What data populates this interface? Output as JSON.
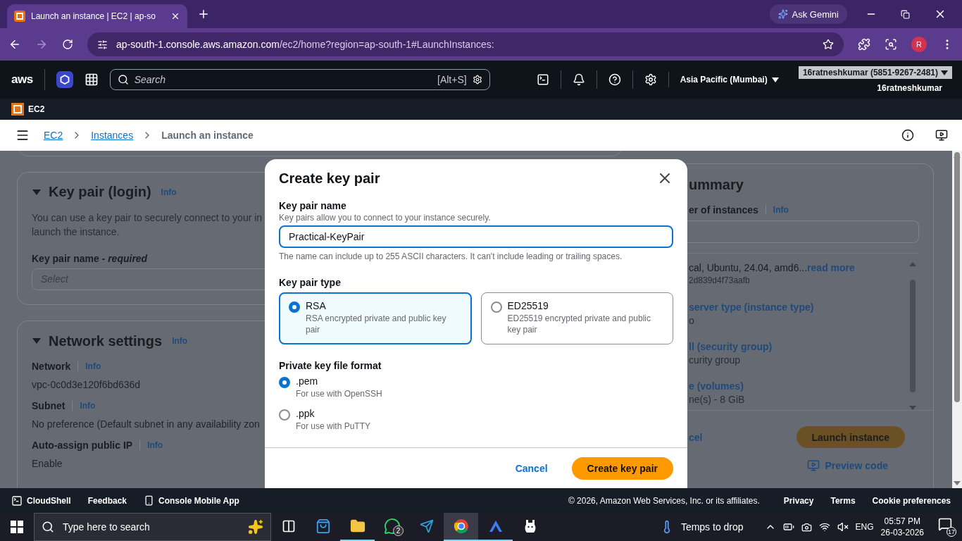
{
  "browser": {
    "tabs": [
      {
        "title": "Launch an instance | EC2 | ap-so",
        "selected": true
      }
    ],
    "ask_button": "Ask Gemini",
    "url_host": "ap-south-1.console.aws.amazon.com",
    "url_path": "/ec2/home?region=ap-south-1#LaunchInstances:",
    "profile_initial": "R"
  },
  "aws_header": {
    "logo": "aws",
    "search_placeholder": "Search",
    "search_shortcut": "[Alt+S]",
    "region": "Asia Pacific (Mumbai)",
    "account": "16ratneshkumar (5851-9267-2481)",
    "username": "16ratneshkumar"
  },
  "service_bar": {
    "service": "EC2"
  },
  "breadcrumbs": [
    {
      "label": "EC2",
      "kind": "link"
    },
    {
      "label": "Instances",
      "kind": "link"
    },
    {
      "label": "Launch an instance",
      "kind": "current"
    }
  ],
  "key_pair_section": {
    "title": "Key pair (login)",
    "info": "Info",
    "expanded": true,
    "description_lines": [
      "You can use a key pair to securely connect to your in",
      "launch the instance."
    ],
    "field_label": "Key pair name - *required*",
    "field_placeholder": "Select"
  },
  "network_section": {
    "title": "Network settings",
    "info": "Info",
    "expanded": true,
    "fields": [
      {
        "label": "Network",
        "info": "Info",
        "value": "vpc-0c0d3e120f6bd636d"
      },
      {
        "label": "Subnet",
        "info": "Info",
        "value": "No preference (Default subnet in any availability zon"
      },
      {
        "label": "Auto-assign public IP",
        "info": "Info",
        "value": "Enable"
      }
    ]
  },
  "summary": {
    "title": "ummary",
    "instances_label": "er of instances",
    "instances_info": "Info",
    "items": [
      {
        "kind": "text",
        "text": "cal, Ubuntu, 24.04, amd6...",
        "link": "read more",
        "sub": "2d839d4f73aafb"
      },
      {
        "kind": "heading",
        "text": "server type (instance type)",
        "sub": "o"
      },
      {
        "kind": "heading",
        "text": "ll (security group)",
        "sub": "curity group"
      },
      {
        "kind": "heading",
        "text": "e (volumes)",
        "sub": "ne(s) - 8 GiB"
      }
    ],
    "cancel": "cel",
    "launch": "Launch instance",
    "preview": "Preview code"
  },
  "modal": {
    "title": "Create key pair",
    "name_label": "Key pair name",
    "name_help": "Key pairs allow you to connect to your instance securely.",
    "name_value": "Practical-KeyPair",
    "name_constraint": "The name can include up to 255 ASCII characters. It can't include leading or trailing spaces.",
    "type_label": "Key pair type",
    "types": [
      {
        "label": "RSA",
        "description": "RSA encrypted private and public key pair",
        "selected": true
      },
      {
        "label": "ED25519",
        "description": "ED25519 encrypted private and public key pair",
        "selected": false
      }
    ],
    "format_label": "Private key file format",
    "formats": [
      {
        "label": ".pem",
        "description": "For use with OpenSSH",
        "selected": true
      },
      {
        "label": ".ppk",
        "description": "For use with PuTTY",
        "selected": false
      }
    ],
    "cancel": "Cancel",
    "submit": "Create key pair"
  },
  "footer": {
    "left": [
      {
        "kind": "cloudshell",
        "label": "CloudShell"
      },
      {
        "kind": "plain",
        "label": "Feedback"
      },
      {
        "kind": "mobile",
        "label": "Console Mobile App"
      }
    ],
    "copyright": "© 2026, Amazon Web Services, Inc. or its affiliates.",
    "links": [
      "Privacy",
      "Terms",
      "Cookie preferences"
    ]
  },
  "taskbar": {
    "search_placeholder": "Type here to search",
    "apps": [
      {
        "kind": "taskview",
        "running": false,
        "active": false
      },
      {
        "kind": "store",
        "running": false,
        "active": false
      },
      {
        "kind": "explorer",
        "running": true,
        "active": false
      },
      {
        "kind": "whatsapp",
        "running": false,
        "active": false,
        "badge": "2"
      },
      {
        "kind": "telegram",
        "running": false,
        "active": false
      },
      {
        "kind": "chrome",
        "running": true,
        "active": true
      },
      {
        "kind": "arc",
        "running": true,
        "active": false
      },
      {
        "kind": "llama",
        "running": false,
        "active": false
      }
    ],
    "weather": "Temps to drop",
    "language": "ENG",
    "time": "05:57 PM",
    "date": "26-03-2026",
    "notifications": "17"
  }
}
